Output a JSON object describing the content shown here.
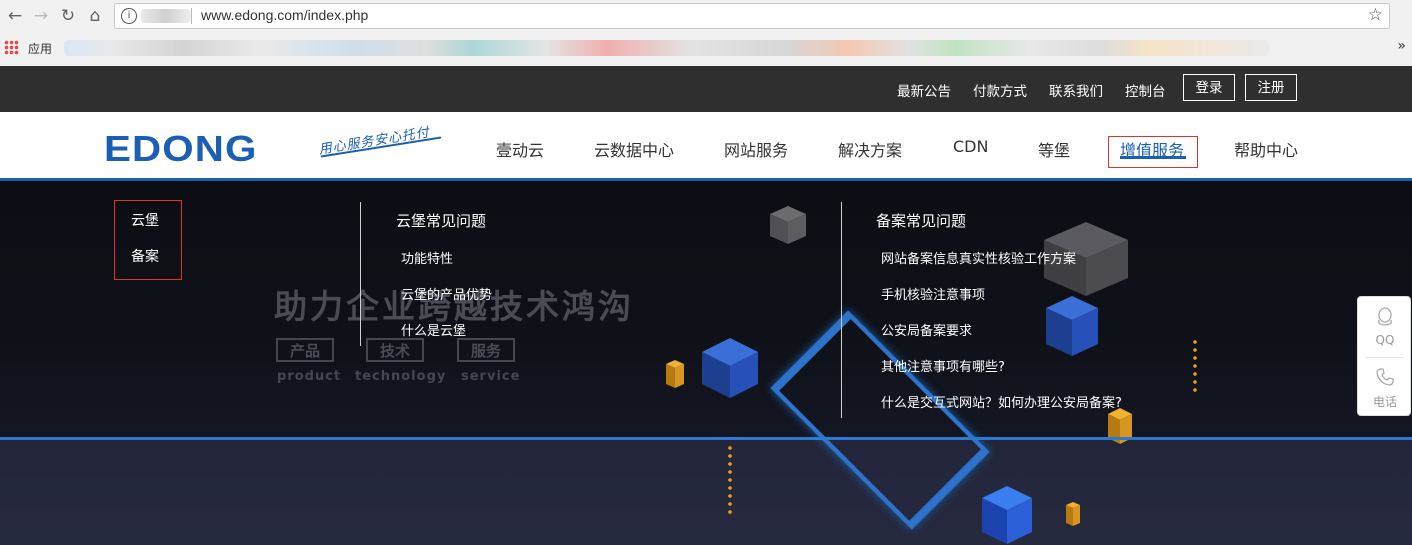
{
  "browser": {
    "url": "www.edong.com/index.php",
    "bookmarks_apps_label": "应用",
    "more_glyph": "»"
  },
  "topbar": {
    "links": [
      "最新公告",
      "付款方式",
      "联系我们",
      "控制台"
    ],
    "login_label": "登录",
    "register_label": "注册"
  },
  "logo": {
    "text": "EDONG",
    "slogan": "用心服务安心托付"
  },
  "nav": {
    "items": [
      "壹动云",
      "云数据中心",
      "网站服务",
      "解决方案",
      "CDN",
      "等堡",
      "增值服务",
      "帮助中心"
    ],
    "active_item": "增值服务"
  },
  "dropdown": {
    "side_items": [
      "云堡",
      "备案"
    ],
    "col1": {
      "heading": "云堡常见问题",
      "links": [
        "功能特性",
        "云堡的产品优势",
        "什么是云堡"
      ]
    },
    "col2": {
      "heading": "备案常见问题",
      "links": [
        "网站备案信息真实性核验工作方案",
        "手机核验注意事项",
        "公安局备案要求",
        "其他注意事项有哪些?",
        "什么是交互式网站？如何办理公安局备案?"
      ]
    }
  },
  "background": {
    "headline": "助力企业跨越技术鸿沟",
    "tags": [
      "产品",
      "技术",
      "服务"
    ],
    "subtags": [
      "product",
      "technology",
      "service"
    ]
  },
  "side_widget": {
    "qq_label": "QQ",
    "phone_label": "电话"
  },
  "colors": {
    "brand_blue": "#1a5fb4",
    "highlight_red": "#e03030",
    "topbar_bg": "#2f2f2f",
    "dropdown_bg": "#0f1118"
  }
}
